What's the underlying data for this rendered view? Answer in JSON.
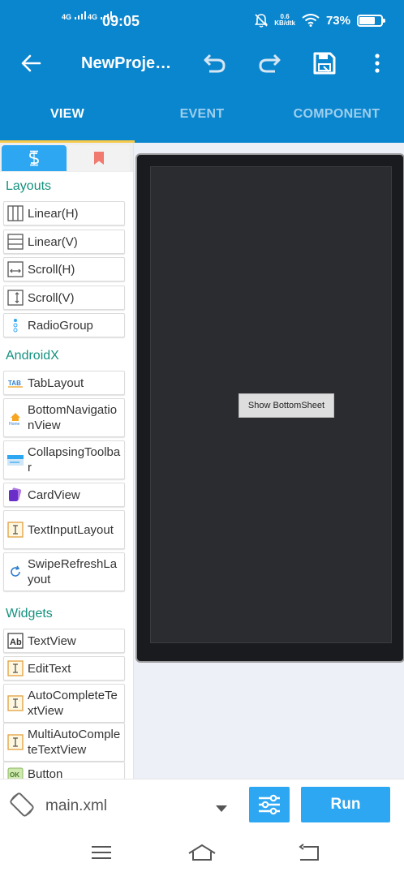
{
  "status_bar": {
    "network_left": "4G",
    "network_right": "4G",
    "time": "09:05",
    "speed_value": "0.6",
    "speed_unit": "KB/dtk",
    "battery": "73%",
    "battery_level": 0.73
  },
  "app_bar": {
    "title": "NewProject...",
    "icons": [
      "back-arrow-icon",
      "undo-icon",
      "redo-icon",
      "save-icon",
      "more-vert-icon"
    ]
  },
  "tabs": [
    {
      "label": "VIEW",
      "active": true
    },
    {
      "label": "EVENT",
      "active": false
    },
    {
      "label": "COMPONENT",
      "active": false
    }
  ],
  "palette": {
    "categories": {
      "layouts": "Layouts",
      "androidx": "AndroidX",
      "widgets": "Widgets"
    },
    "layouts": [
      {
        "label": "Linear(H)",
        "icon": "linear-horizontal-icon"
      },
      {
        "label": "Linear(V)",
        "icon": "linear-vertical-icon"
      },
      {
        "label": "Scroll(H)",
        "icon": "scroll-horizontal-icon"
      },
      {
        "label": "Scroll(V)",
        "icon": "scroll-vertical-icon"
      },
      {
        "label": "RadioGroup",
        "icon": "radiogroup-icon"
      }
    ],
    "androidx": [
      {
        "label": "TabLayout",
        "icon": "tablayout-icon"
      },
      {
        "label": "BottomNavigationView",
        "icon": "bottom-navigation-icon"
      },
      {
        "label": "CollapsingToolbar",
        "icon": "collapsing-toolbar-icon"
      },
      {
        "label": "CardView",
        "icon": "cardview-icon"
      },
      {
        "label": "TextInputLayout",
        "icon": "textinput-icon"
      },
      {
        "label": "SwipeRefreshLayout",
        "icon": "refresh-icon"
      }
    ],
    "widgets": [
      {
        "label": "TextView",
        "icon": "textview-icon"
      },
      {
        "label": "EditText",
        "icon": "edittext-icon"
      },
      {
        "label": "AutoCompleteTextView",
        "icon": "autocomplete-icon"
      },
      {
        "label": "MultiAutoCompleteTextView",
        "icon": "multiautocomplete-icon"
      },
      {
        "label": "Button",
        "icon": "button-icon"
      }
    ]
  },
  "preview": {
    "button_label": "Show BottomSheet"
  },
  "bottom_bar": {
    "file_name": "main.xml",
    "run_label": "Run"
  },
  "colors": {
    "primary": "#0a86cf",
    "accent_blue": "#2ea7f2",
    "category_teal": "#14917f",
    "tab_indicator": "#f7c948"
  }
}
